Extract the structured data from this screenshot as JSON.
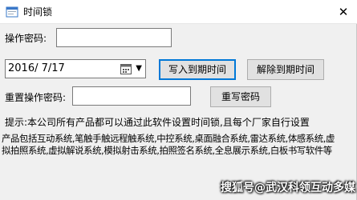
{
  "window": {
    "title": "时间锁",
    "close_glyph": "✕"
  },
  "form": {
    "password_label": "操作密码:",
    "password_value": "",
    "date_value": "2016/ 7/17",
    "write_expiry_button": "写入到期时间",
    "clear_expiry_button": "解除到期时间",
    "reset_password_label": "重置操作密码:",
    "reset_password_value": "",
    "rewrite_password_button": "重写密码"
  },
  "notice": {
    "hint": "提示:本公司所有产品都可以通过此软件设置时间锁,且每个厂家自行设置",
    "description": "产品包括互动系统,笔触手触远程触系统,中控系统,桌面融合系统,雷达系统,体感系统,虚拟拍照系统,虚拟解说系统,模拟射击系统,拍照签名系统,全息展示系统,白板书写软件等"
  },
  "watermark": "搜狐号@武汉科领互动多媒",
  "icons": {
    "app": "app-window-icon",
    "close": "close-icon",
    "calendar": "calendar-icon",
    "dropdown": "chevron-down-icon"
  },
  "colors": {
    "window_bg": "#f0f0f0",
    "button_bg": "#e1e1e1",
    "focus_border": "#0078d7"
  }
}
